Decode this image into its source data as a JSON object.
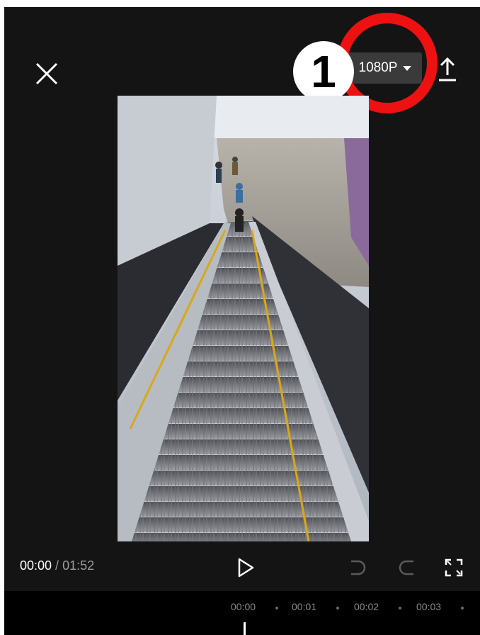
{
  "header": {
    "resolution_label": "1080P",
    "close_icon": "close-icon",
    "resolution_dropdown_icon": "caret-down-icon",
    "export_icon": "upload-icon"
  },
  "annotation": {
    "step_number": "1",
    "ring_color": "#ee1111"
  },
  "preview": {
    "content": "video-frame-escalator"
  },
  "playback": {
    "current_time": "00:00",
    "separator": " / ",
    "total_time": "01:52",
    "play_icon": "play-icon",
    "undo_icon": "undo-icon",
    "redo_icon": "redo-icon",
    "fullscreen_icon": "fullscreen-icon"
  },
  "timeline": {
    "ticks": [
      "00:00",
      "00:01",
      "00:02",
      "00:03"
    ]
  },
  "colors": {
    "background": "#141414",
    "timeline_background": "#000000",
    "resolution_button": "#3a3a3a",
    "secondary_text": "#9a9a9a"
  }
}
